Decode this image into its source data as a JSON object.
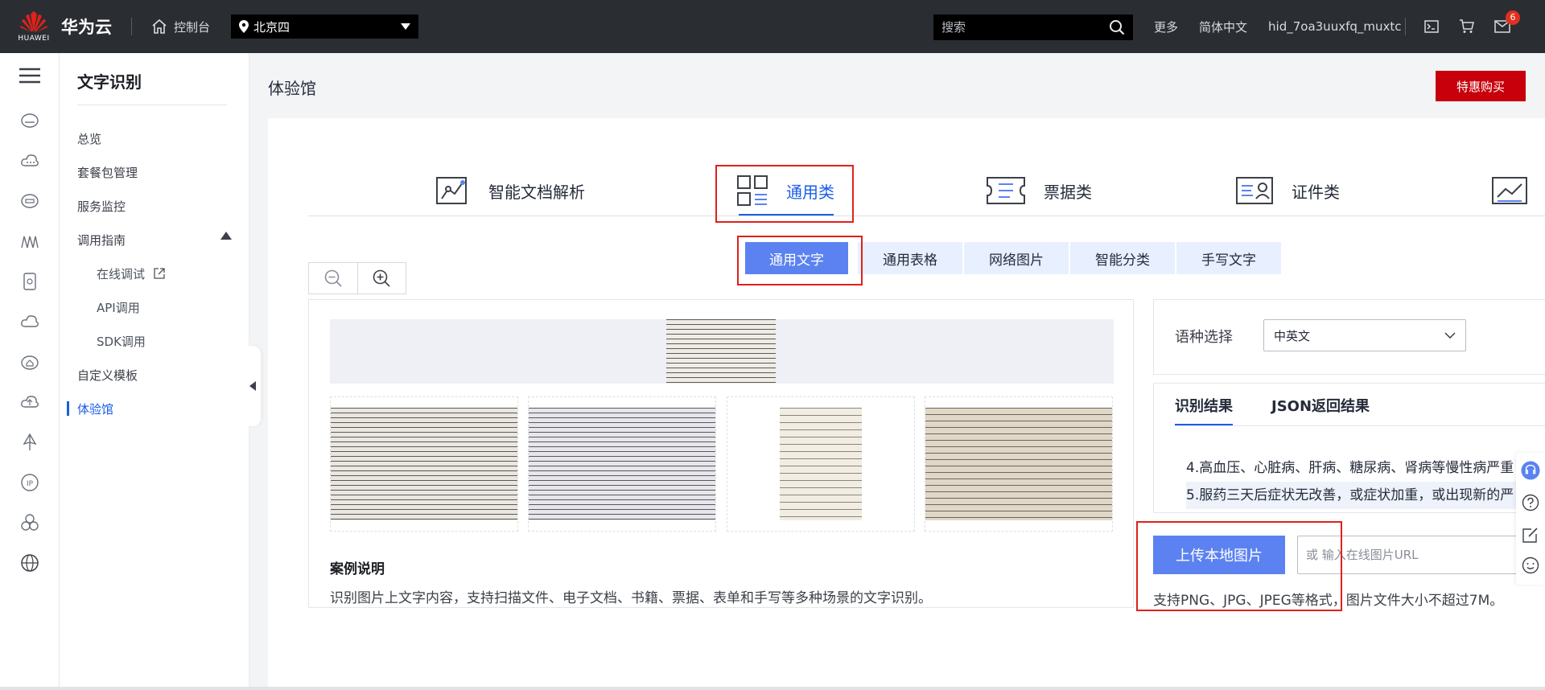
{
  "topbar": {
    "brand_word": "HUAWEI",
    "brand_name": "华为云",
    "console": "控制台",
    "region": "北京四",
    "search_placeholder": "搜索",
    "links": [
      "更多",
      "简体中文",
      "hid_7oa3uuxfq_muxtc"
    ],
    "notification_count": "6"
  },
  "sidebar": {
    "title": "文字识别",
    "items": [
      {
        "label": "总览"
      },
      {
        "label": "套餐包管理"
      },
      {
        "label": "服务监控"
      },
      {
        "label": "调用指南"
      },
      {
        "label": "在线调试"
      },
      {
        "label": "API调用"
      },
      {
        "label": "SDK调用"
      },
      {
        "label": "自定义模板"
      },
      {
        "label": "体验馆"
      }
    ]
  },
  "main": {
    "page_title": "体验馆",
    "buy_button": "特惠购买",
    "categories": [
      {
        "label": "智能文档解析"
      },
      {
        "label": "通用类"
      },
      {
        "label": "票据类"
      },
      {
        "label": "证件类"
      }
    ],
    "sub_tabs": [
      {
        "label": "通用文字"
      },
      {
        "label": "通用表格"
      },
      {
        "label": "网络图片"
      },
      {
        "label": "智能分类"
      },
      {
        "label": "手写文字"
      }
    ],
    "case_title": "案例说明",
    "case_desc": "识别图片上文字内容，支持扫描文件、电子文档、书籍、票据、表单和手写等多种场景的文字识别。"
  },
  "right": {
    "lang_label": "语种选择",
    "lang_value": "中英文",
    "result_tabs": [
      "识别结果",
      "JSON返回结果"
    ],
    "result_lines": [
      "4.高血压、心脏病、肝病、糖尿病、肾病等慢性病严重",
      "5.服药三天后症状无改善，或症状加重，或出现新的严"
    ],
    "upload_button": "上传本地图片",
    "url_placeholder": "或 输入在线图片URL",
    "hint": "支持PNG、JPG、JPEG等格式，图片文件大小不超过7M。"
  },
  "colors": {
    "accent": "#1a5de8",
    "accent_button": "#5b82f0",
    "brand_red": "#c7000b",
    "highlight_box": "#e0211b",
    "topbar_bg": "#2a2e33"
  }
}
